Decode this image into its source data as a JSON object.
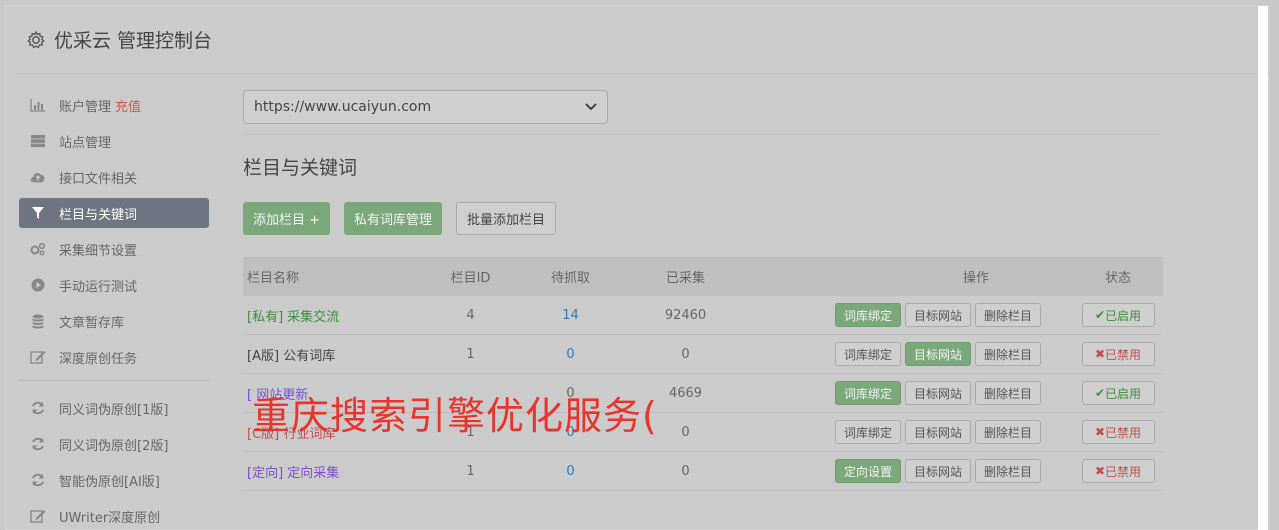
{
  "header": {
    "title": "优采云 管理控制台"
  },
  "sidebar": {
    "items": [
      {
        "label": "账户管理",
        "icon": "bar-chart-icon",
        "extra": "充值"
      },
      {
        "label": "站点管理",
        "icon": "server-icon"
      },
      {
        "label": "接口文件相关",
        "icon": "cloud-upload-icon"
      },
      {
        "label": "栏目与关键词",
        "icon": "filter-icon",
        "active": true
      },
      {
        "label": "采集细节设置",
        "icon": "gears-icon"
      },
      {
        "label": "手动运行测试",
        "icon": "play-circle-icon"
      },
      {
        "label": "文章暂存库",
        "icon": "database-icon"
      },
      {
        "label": "深度原创任务",
        "icon": "edit-icon"
      }
    ],
    "items2": [
      {
        "label": "同义词伪原创[1版]",
        "icon": "refresh-icon"
      },
      {
        "label": "同义词伪原创[2版]",
        "icon": "refresh-icon"
      },
      {
        "label": "智能伪原创[AI版]",
        "icon": "refresh-icon"
      },
      {
        "label": "UWriter深度原创",
        "icon": "edit-icon"
      }
    ]
  },
  "main": {
    "site_select": "https://www.ucaiyun.com",
    "section_title": "栏目与关键词",
    "buttons": {
      "add": "添加栏目 +",
      "private": "私有词库管理",
      "batch": "批量添加栏目"
    },
    "table": {
      "headers": [
        "栏目名称",
        "栏目ID",
        "待抓取",
        "已采集",
        "操作",
        "状态"
      ],
      "rows": [
        {
          "tag": "[私有]",
          "name": "采集交流",
          "id": "4",
          "pending": "14",
          "collected": "92460",
          "op1": "词库绑定",
          "op2": "目标网站",
          "op3": "删除栏目",
          "status": "已启用"
        },
        {
          "tag": "[A版]",
          "name": "公有词库",
          "id": "1",
          "pending": "0",
          "collected": "0",
          "op1": "词库绑定",
          "op2": "目标网站",
          "op3": "删除栏目",
          "status": "已禁用"
        },
        {
          "tag": "[",
          "name": "网站更新",
          "id": "",
          "pending": "0",
          "collected": "4669",
          "op1": "词库绑定",
          "op2": "目标网站",
          "op3": "删除栏目",
          "status": "已启用"
        },
        {
          "tag": "[C版]",
          "name": "行业词库",
          "id": "1",
          "pending": "0",
          "collected": "0",
          "op1": "词库绑定",
          "op2": "目标网站",
          "op3": "删除栏目",
          "status": "已禁用"
        },
        {
          "tag": "[定向]",
          "name": "定向采集",
          "id": "1",
          "pending": "0",
          "collected": "0",
          "op1": "定向设置",
          "op2": "目标网站",
          "op3": "删除栏目",
          "status": "已禁用"
        }
      ]
    }
  },
  "overlay_text": "重庆搜索引擎优化服务(",
  "colors": {
    "accent_green": "#7aa87a",
    "danger": "#c0504d",
    "active_nav": "#6f7580"
  }
}
